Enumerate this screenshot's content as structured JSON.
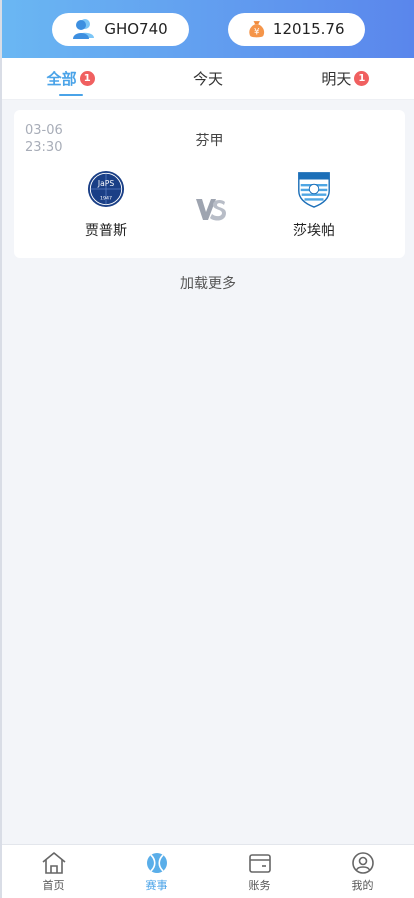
{
  "header": {
    "username": "GHO740",
    "balance": "12015.76",
    "balance_icon_glyph": "¥"
  },
  "tabs": [
    {
      "label": "全部",
      "badge": "1",
      "active": true
    },
    {
      "label": "今天",
      "badge": "",
      "active": false
    },
    {
      "label": "明天",
      "badge": "1",
      "active": false
    }
  ],
  "match": {
    "date": "03-06",
    "time": "23:30",
    "league": "芬甲",
    "home_team": "贾普斯",
    "away_team": "莎埃帕",
    "home_logo_text": "JaPS",
    "home_logo_year": "1947"
  },
  "load_more": "加载更多",
  "nav": [
    {
      "label": "首页",
      "icon": "home-icon"
    },
    {
      "label": "赛事",
      "icon": "ball-icon"
    },
    {
      "label": "账务",
      "icon": "wallet-icon"
    },
    {
      "label": "我的",
      "icon": "profile-icon"
    }
  ],
  "colors": {
    "accent": "#4aa3e8",
    "badge": "#f06060",
    "header_start": "#6ab7f3",
    "header_end": "#5a86ec"
  }
}
